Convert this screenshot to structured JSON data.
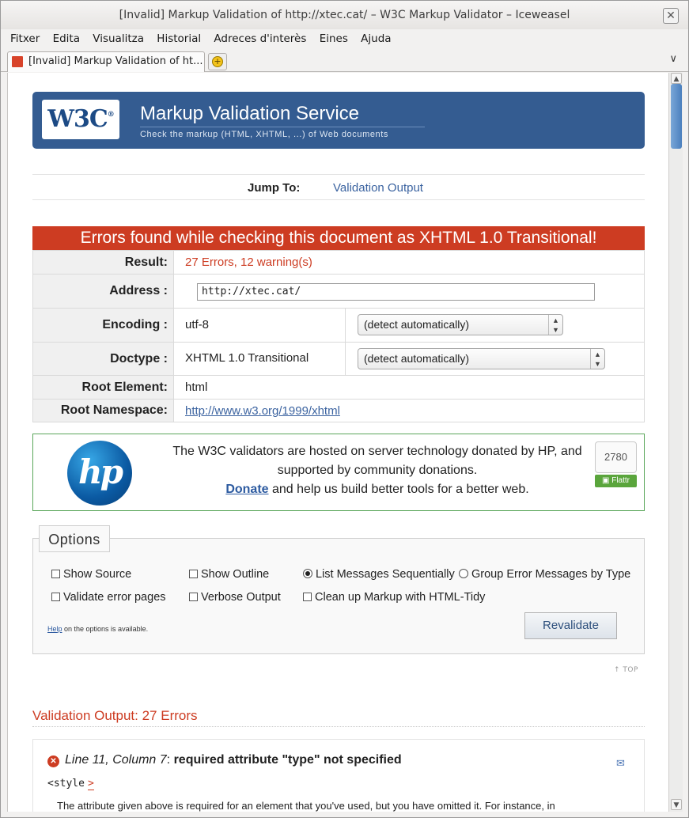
{
  "window": {
    "title": "[Invalid] Markup Validation of http://xtec.cat/ – W3C Markup Validator – Iceweasel",
    "close_glyph": "✕"
  },
  "menu": [
    "Fitxer",
    "Edita",
    "Visualitza",
    "Historial",
    "Adreces d'interès",
    "Eines",
    "Ajuda"
  ],
  "tab": {
    "label": "[Invalid] Markup Validation of ht...",
    "close_glyph": "✕",
    "new_tab_glyph": "+",
    "list_glyph": "∨"
  },
  "banner": {
    "logo_text": "W3C",
    "logo_mark": "®",
    "title": "Markup Validation Service",
    "subtitle": "Check the markup (HTML, XHTML, ...) of Web documents"
  },
  "jump": {
    "label": "Jump To:",
    "link": "Validation Output"
  },
  "result": {
    "headline": "Errors found while checking this document as XHTML 1.0 Transitional!",
    "result_label": "Result:",
    "result_value": "27 Errors, 12 warning(s)",
    "address_label": "Address :",
    "address_value": "http://xtec.cat/",
    "encoding_label": "Encoding :",
    "encoding_value": "utf-8",
    "encoding_select": "(detect automatically)",
    "doctype_label": "Doctype :",
    "doctype_value": "XHTML 1.0 Transitional",
    "doctype_select": "(detect automatically)",
    "root_element_label": "Root Element:",
    "root_element_value": "html",
    "root_ns_label": "Root Namespace:",
    "root_ns_value": "http://www.w3.org/1999/xhtml"
  },
  "sponsor": {
    "logo_text": "hp",
    "line1": "The W3C validators are hosted on server technology donated by HP, and supported by community donations.",
    "donate": "Donate",
    "line2": " and help us build better tools for a better web.",
    "flattr_count": "2780",
    "flattr_label": "Flattr"
  },
  "options": {
    "legend": "Options",
    "show_source": "Show Source",
    "show_outline": "Show Outline",
    "list_seq": "List Messages Sequentially",
    "group_errors": "Group Error Messages by Type",
    "validate_error_pages": "Validate error pages",
    "verbose_output": "Verbose Output",
    "cleanup_tidy": "Clean up Markup with HTML-Tidy",
    "help_link": "Help",
    "help_rest": " on the options is available.",
    "revalidate": "Revalidate",
    "list_seq_selected": true
  },
  "top_link": "↑ TOP",
  "validation": {
    "title": "Validation Output: 27 Errors",
    "messages": [
      {
        "location": "Line 11, Column 7",
        "title": "required attribute \"type\" not specified",
        "code": "<style",
        "code_marker": ">",
        "explanation": "The attribute given above is required for an element that you've used, but you have omitted it. For instance, in"
      }
    ]
  }
}
